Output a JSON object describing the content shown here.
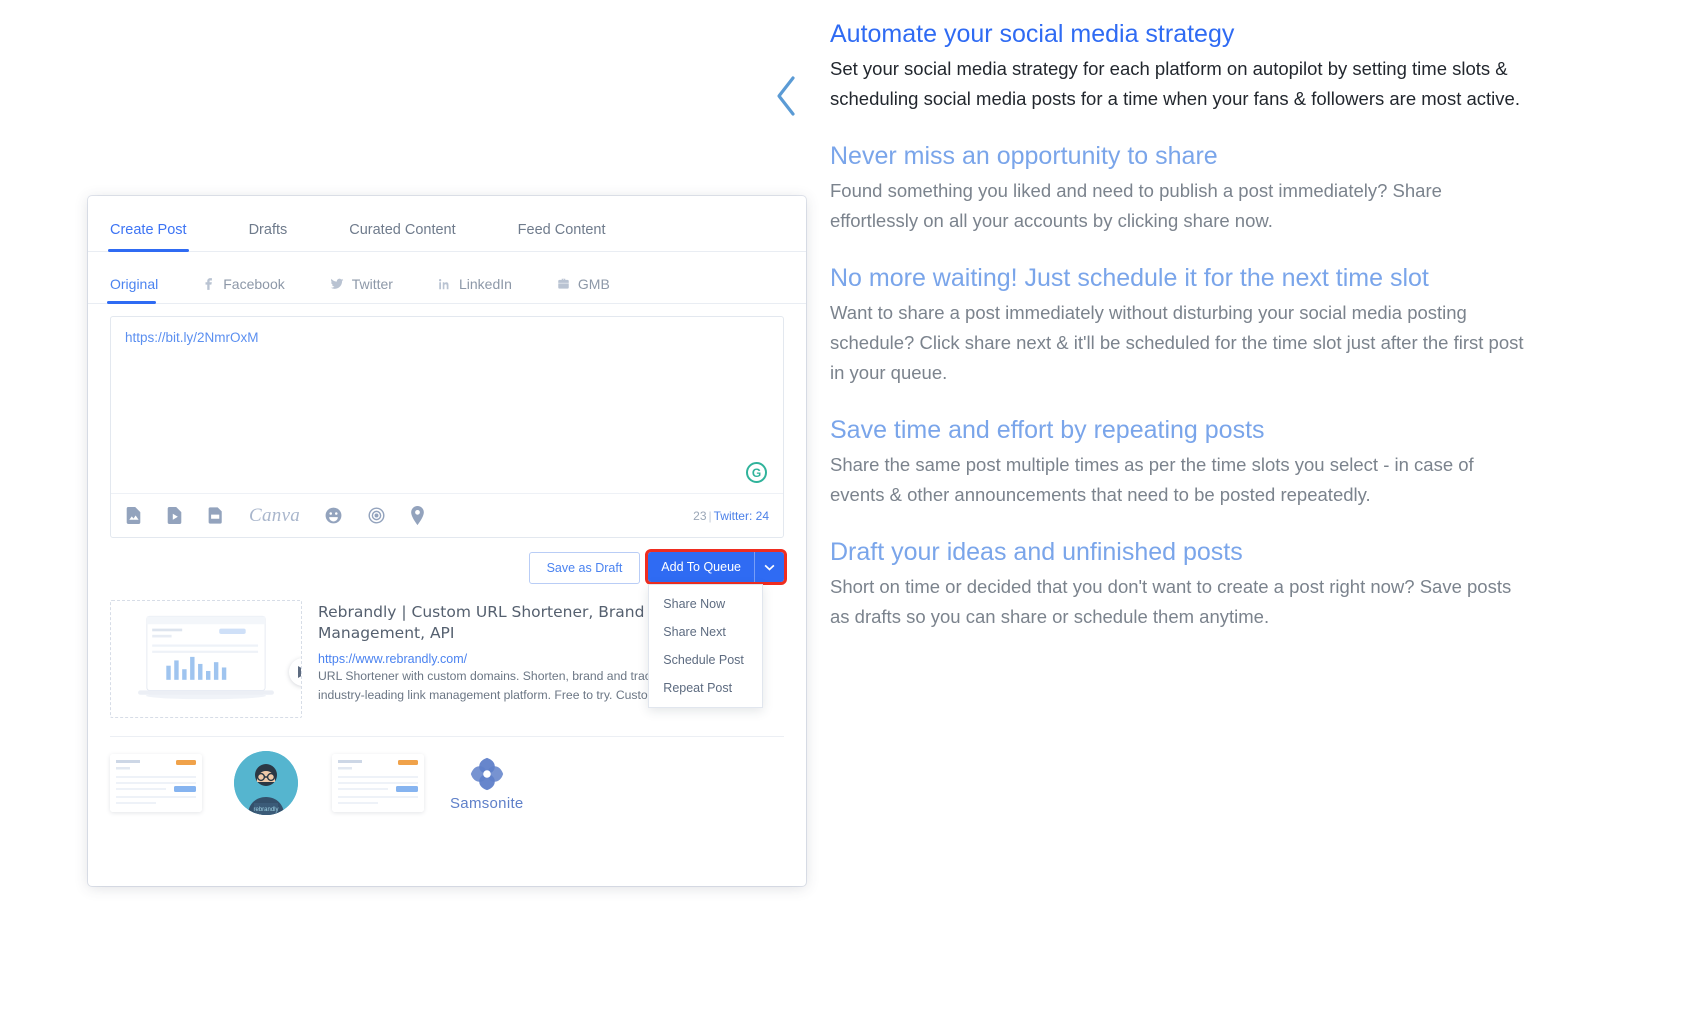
{
  "app": {
    "tabs": [
      {
        "label": "Create Post",
        "active": true
      },
      {
        "label": "Drafts",
        "active": false
      },
      {
        "label": "Curated Content",
        "active": false
      },
      {
        "label": "Feed Content",
        "active": false
      }
    ],
    "channels": [
      {
        "label": "Original",
        "icon": "none",
        "active": true
      },
      {
        "label": "Facebook",
        "icon": "facebook-icon",
        "active": false
      },
      {
        "label": "Twitter",
        "icon": "twitter-icon",
        "active": false
      },
      {
        "label": "LinkedIn",
        "icon": "linkedin-icon",
        "active": false
      },
      {
        "label": "GMB",
        "icon": "gmb-icon",
        "active": false
      }
    ],
    "editor": {
      "content": "https://bit.ly/2NmrOxM",
      "grammarly_icon": "grammarly-icon",
      "grammarly_glyph": "G",
      "toolbar_icons": [
        "image-upload-icon",
        "video-upload-icon",
        "gif-icon",
        "canva-icon",
        "emoji-icon",
        "target-icon",
        "location-pin-icon"
      ],
      "canva_label": "Canva",
      "counter": {
        "count": "23",
        "separator": "|",
        "platform": "Twitter: 24"
      }
    },
    "buttons": {
      "save_draft": "Save as Draft",
      "add_to_queue": "Add To Queue",
      "caret_icon": "chevron-down-icon"
    },
    "dropdown": {
      "items": [
        "Share Now",
        "Share Next",
        "Schedule Post",
        "Repeat Post"
      ]
    },
    "preview": {
      "title": "Rebrandly | Custom URL Shortener, Brand Link Management, API",
      "url": "https://www.rebrandly.com/",
      "description": "URL Shortener with custom domains. Shorten, brand and track URLs with the industry-leading link management platform. Free to try. Custom Domains.",
      "next_arrow_icon": "play-arrow-icon"
    },
    "thumbnails": [
      {
        "name": "dashboard-thumb-1",
        "type": "screenshot"
      },
      {
        "name": "avatar-thumb",
        "type": "avatar"
      },
      {
        "name": "dashboard-thumb-2",
        "type": "screenshot"
      },
      {
        "name": "samsonite-logo",
        "type": "logo",
        "label": "Samsonite"
      }
    ]
  },
  "panel": {
    "collapse_icon": "chevron-left-icon",
    "sections": [
      {
        "heading": "Automate your social media strategy",
        "body": "Set your social media strategy for each platform on autopilot by setting time slots & scheduling social media posts for a time when your fans & followers are most active."
      },
      {
        "heading": "Never miss an opportunity to share",
        "body": "Found something you liked and need to publish a post immediately? Share effortlessly on all your accounts by clicking share now."
      },
      {
        "heading": "No more waiting! Just schedule it for the next time slot",
        "body": "Want to share a post immediately without disturbing your social media posting schedule? Click share next & it'll be scheduled for the time slot just after the first post in your queue."
      },
      {
        "heading": "Save time and effort by repeating posts",
        "body": "Share the same post multiple times as per the time slots you select - in case of events & other announcements that need to be posted repeatedly."
      },
      {
        "heading": "Draft your ideas and unfinished posts",
        "body": "Short on time or decided that you don't want to create a post right now? Save posts as drafts so you can share or schedule them anytime."
      }
    ]
  },
  "colors": {
    "accent_blue": "#2f6bf3",
    "light_blue": "#7aa5ea",
    "highlight_red": "#ef2d20",
    "grammarly_green": "#30b39b"
  }
}
